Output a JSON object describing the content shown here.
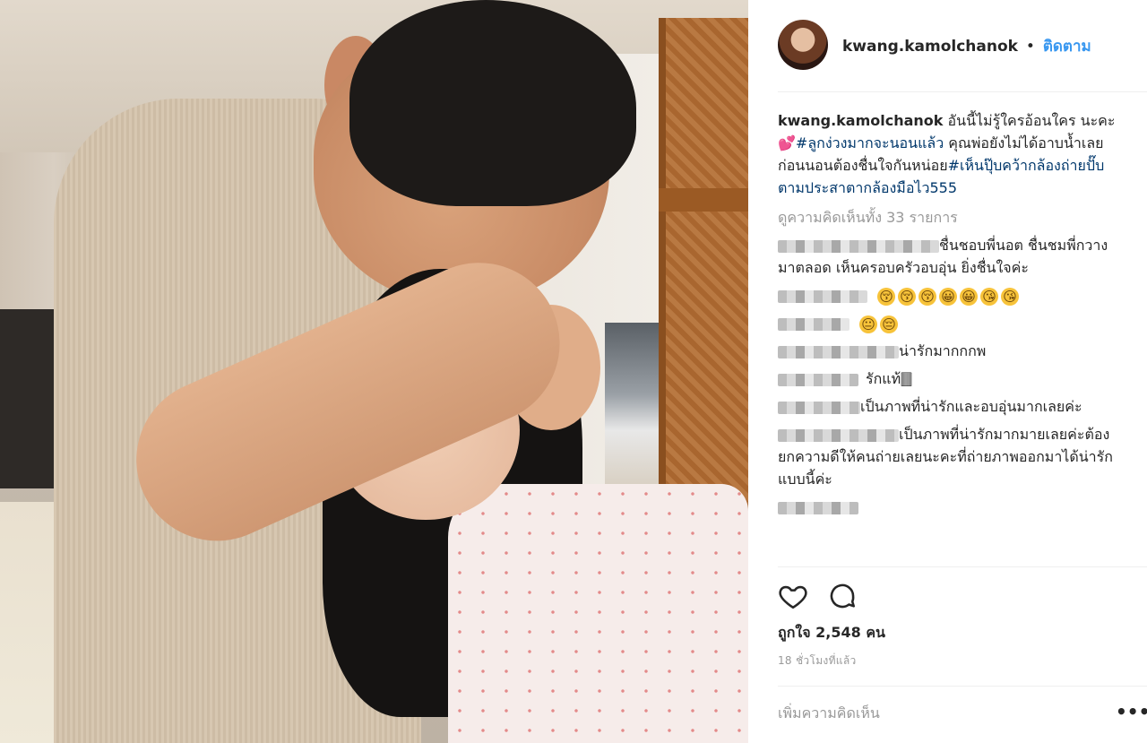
{
  "header": {
    "username": "kwang.kamolchanok",
    "separator": "•",
    "follow_label": "ติดตาม"
  },
  "caption": {
    "username": "kwang.kamolchanok",
    "text_part1": "อันนี้ไม่รู้ใครอ้อนใคร นะคะ💕",
    "hashtag1": "#ลูกง่วงมากจะนอนแล้ว",
    "text_part2": " คุณพ่อยังไม่ได้อาบน้ำเลย ก่อนนอนต้องชื่นใจกันหน่อย",
    "hashtag2": "#เห็นปุ๊บคว้ากล้องถ่ายปั๊บตามประสาตากล้องมือไว555"
  },
  "view_all_comments": "ดูความคิดเห็นทั้ง 33 รายการ",
  "comments": [
    {
      "text": "ชื่นชอบพี่นอต ชื่นชมพี่กวางมาตลอด เห็นครอบครัวอบอุ่น ยิ่งชื่นใจค่ะ"
    },
    {
      "text": ""
    },
    {
      "text": ""
    },
    {
      "text": "น่ารักมากกกพ"
    },
    {
      "text": "รักแท้🀫"
    },
    {
      "text": "เป็นภาพที่น่ารักและอบอุ่นมากเลยค่ะ"
    },
    {
      "text": "เป็นภาพที่น่ารักมากมายเลยค่ะต้องยกความดีให้คนถ่ายเลยนะคะที่ถ่ายภาพออกมาได้น่ารักแบบนี้ค่ะ"
    },
    {
      "text": ""
    }
  ],
  "emoji_rows": {
    "row1": [
      "😚",
      "😚",
      "😚",
      "😀",
      "😀",
      "😘",
      "😘"
    ],
    "row2": [
      "😐",
      "😔"
    ]
  },
  "icons": {
    "like": "heart-icon",
    "comment": "comment-icon",
    "more": "more-options-icon"
  },
  "likes_text": "ถูกใจ 2,548 คน",
  "time_text": "18 ชั่วโมงที่แล้ว",
  "add_comment_placeholder": "เพิ่มความคิดเห็น",
  "more_label": "•••",
  "colors": {
    "link": "#00376b",
    "follow": "#3897f0",
    "muted": "#999999"
  }
}
